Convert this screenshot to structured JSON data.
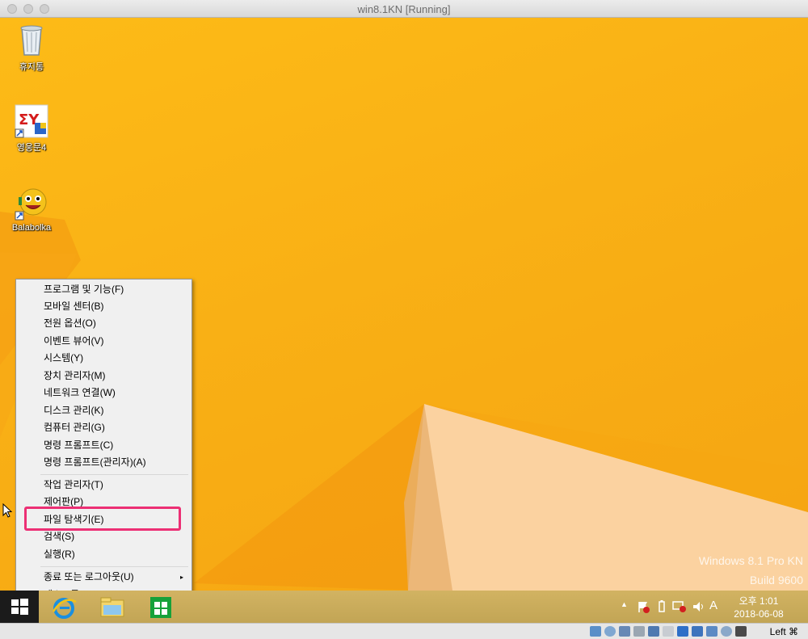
{
  "window": {
    "title": "win8.1KN [Running]"
  },
  "desktop_icons": [
    {
      "label": "휴지통",
      "icon": "recycle-bin-icon"
    },
    {
      "label": "영웅문4",
      "icon": "kiwoom-app-icon"
    },
    {
      "label": "Balabolka",
      "icon": "balabolka-icon"
    }
  ],
  "watermark": {
    "line1": "Windows 8.1 Pro KN",
    "line2": "Build 9600"
  },
  "context_menu": {
    "group1": [
      "프로그램 및 기능(F)",
      "모바일 센터(B)",
      "전원 옵션(O)",
      "이벤트 뷰어(V)",
      "시스템(Y)",
      "장치 관리자(M)",
      "네트워크 연결(W)",
      "디스크 관리(K)",
      "컴퓨터 관리(G)",
      "명령 프롬프트(C)",
      "명령 프롬프트(관리자)(A)"
    ],
    "group2": [
      "작업 관리자(T)",
      "제어판(P)",
      "파일 탐색기(E)",
      "검색(S)",
      "실행(R)"
    ],
    "group3": [
      "종료 또는 로그아웃(U)",
      "데스크톱(D)"
    ],
    "submenu_arrow": "▸"
  },
  "taskbar": {
    "ime_indicator": "A",
    "tray_expand": "▲",
    "clock_time": "오후 1:01",
    "clock_date": "2018-06-08"
  },
  "statusbar": {
    "host_key": "Left ⌘"
  },
  "colors": {
    "highlight": "#ec2f74",
    "wallpaper": "#fbb117"
  }
}
